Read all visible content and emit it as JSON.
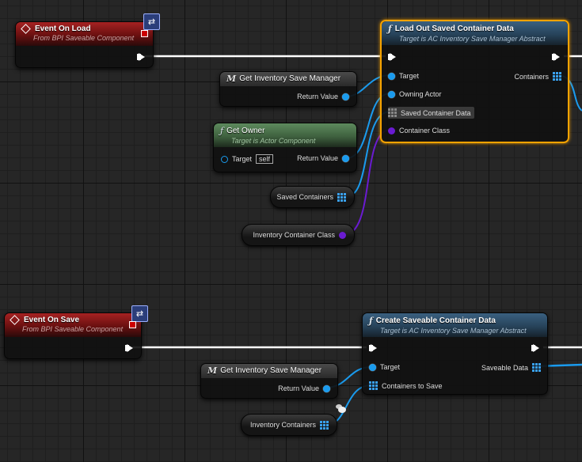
{
  "colors": {
    "exec_wire": "#ffffff",
    "object_wire": "#1a9bee",
    "class_wire": "#6a1bd1",
    "selection": "#f6a300"
  },
  "event_load": {
    "title": "Event On Load",
    "subtitle": "From BPI Saveable Component",
    "icon": "interface-event-icon"
  },
  "load_func": {
    "title": "Load Out Saved Container Data",
    "subtitle": "Target is AC Inventory Save Manager Abstract",
    "pins_in": [
      "Target",
      "Owning Actor",
      "Saved Container Data",
      "Container Class"
    ],
    "pins_out": [
      "Containers"
    ]
  },
  "get_manager_1": {
    "title": "Get Inventory Save Manager",
    "out": "Return Value"
  },
  "get_owner": {
    "title": "Get Owner",
    "subtitle": "Target is Actor Component",
    "target_label": "Target",
    "target_value": "self",
    "out": "Return Value"
  },
  "var_saved_containers": {
    "label": "Saved Containers"
  },
  "var_container_class": {
    "label": "Inventory Container Class"
  },
  "event_save": {
    "title": "Event On Save",
    "subtitle": "From BPI Saveable Component",
    "icon": "interface-event-icon"
  },
  "create_func": {
    "title": "Create Saveable Container Data",
    "subtitle": "Target is AC Inventory Save Manager Abstract",
    "pins_in": [
      "Target",
      "Containers to Save"
    ],
    "pins_out": [
      "Saveable Data"
    ]
  },
  "get_manager_2": {
    "title": "Get Inventory Save Manager",
    "out": "Return Value"
  },
  "var_inventory_containers": {
    "label": "Inventory Containers"
  }
}
